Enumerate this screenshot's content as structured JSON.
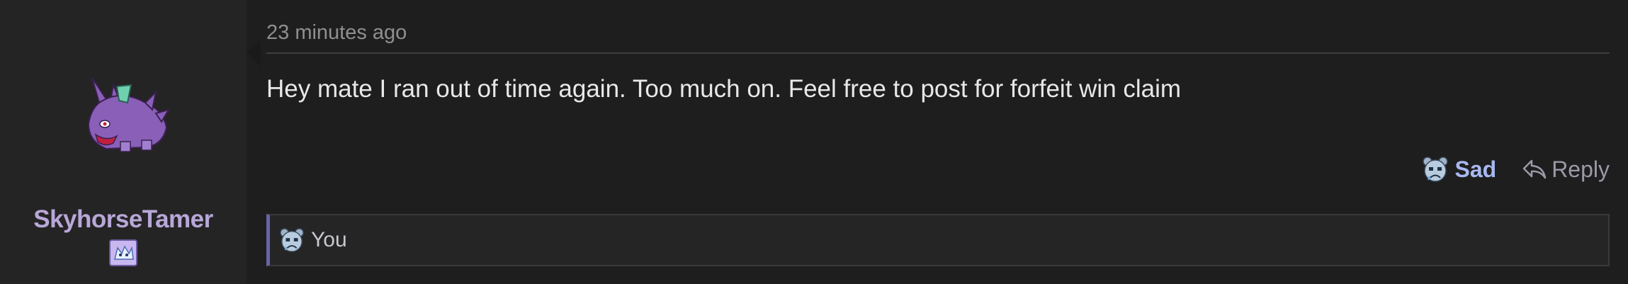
{
  "user": {
    "name": "SkyhorseTamer",
    "avatar_icon": "nidoking-sprite-icon",
    "badge_icon": "pokemon-badge-icon"
  },
  "post": {
    "timestamp": "23 minutes ago",
    "message": "Hey mate I ran out of time again. Too much on. Feel free to post for forfeit win claim"
  },
  "actions": {
    "reaction_label": "Sad",
    "reaction_icon": "sad-face-icon",
    "reply_label": "Reply",
    "reply_icon": "reply-arrow-icon"
  },
  "reactions": {
    "by": "You",
    "icon": "sad-face-icon"
  },
  "colors": {
    "background": "#1e1e1e",
    "user_panel": "#242424",
    "username": "#b8a7d8",
    "reaction_accent": "#a8b8f0",
    "reactions_border": "#6a64a8"
  }
}
